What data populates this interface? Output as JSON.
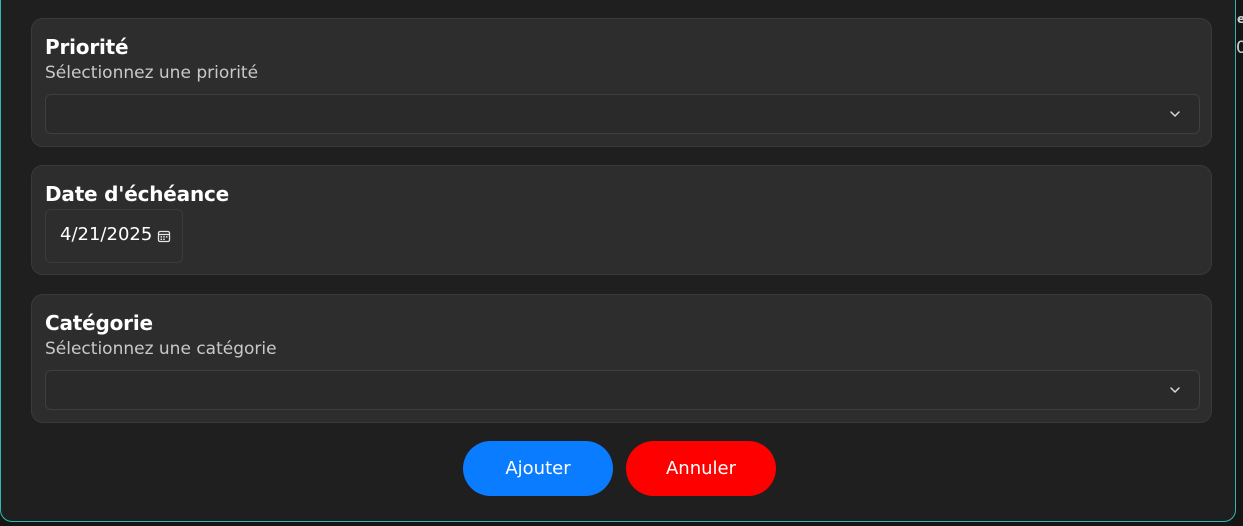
{
  "backdrop": {
    "fragment_1": "e",
    "fragment_2": "0"
  },
  "form": {
    "priority": {
      "title": "Priorité",
      "subtitle": "Sélectionnez une priorité",
      "selected_value": ""
    },
    "due_date": {
      "title": "Date d'échéance",
      "value": "4/21/2025"
    },
    "category": {
      "title": "Catégorie",
      "subtitle": "Sélectionnez une catégorie",
      "selected_value": ""
    }
  },
  "actions": {
    "add_label": "Ajouter",
    "cancel_label": "Annuler"
  },
  "icons": {
    "select_chevron": "chevron-down-icon",
    "date_picker": "calendar-icon"
  },
  "colors": {
    "accent_border": "#2fb7b0",
    "add_button": "#0a7cff",
    "cancel_button": "#ff0000",
    "card_bg": "#2d2d2d",
    "modal_bg": "#1f1f1f"
  }
}
